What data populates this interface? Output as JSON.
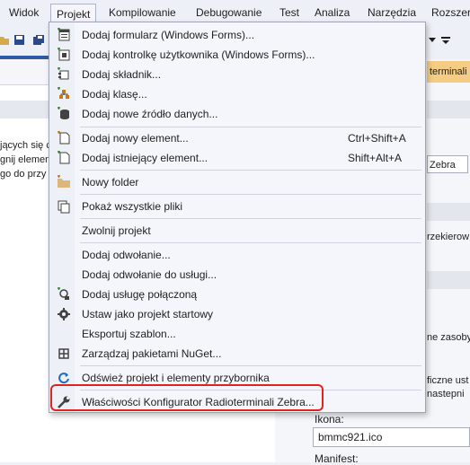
{
  "menubar": {
    "items": [
      "Widok",
      "Projekt",
      "Kompilowanie",
      "Debugowanie",
      "Test",
      "Analiza",
      "Narzędzia",
      "Rozszerz"
    ],
    "active": "Projekt"
  },
  "left_pane": {
    "lines": [
      "jących się c",
      "gnij elemen",
      "go do przy"
    ]
  },
  "right_pane": {
    "tab_label": "terminali",
    "field_zebra": "Zebra",
    "text_zakodowany": "rzekierow",
    "text_zasoby": "ne zasoby",
    "text_ficzne": "ficzne ust",
    "text_nastepni": "nastepni",
    "icon_label": "Ikona:",
    "icon_value": "bmmc921.ico",
    "manifest_label": "Manifest:"
  },
  "project_menu": {
    "items": [
      {
        "label": "Dodaj formularz (Windows Forms)...",
        "shortcut": "",
        "icon": "form-icon"
      },
      {
        "label": "Dodaj kontrolkę użytkownika (Windows Forms)...",
        "shortcut": "",
        "icon": "user-control-icon"
      },
      {
        "label": "Dodaj składnik...",
        "shortcut": "",
        "icon": "component-icon"
      },
      {
        "label": "Dodaj klasę...",
        "shortcut": "",
        "icon": "class-icon"
      },
      {
        "label": "Dodaj nowe źródło danych...",
        "shortcut": "",
        "icon": "datasource-icon"
      },
      {
        "label": "Dodaj nowy element...",
        "shortcut": "Ctrl+Shift+A",
        "icon": "new-item-icon"
      },
      {
        "label": "Dodaj istniejący element...",
        "shortcut": "Shift+Alt+A",
        "icon": "existing-item-icon"
      },
      {
        "label": "Nowy folder",
        "shortcut": "",
        "icon": "folder-icon"
      },
      {
        "label": "Pokaż wszystkie pliki",
        "shortcut": "",
        "icon": "show-all-files-icon"
      },
      {
        "label": "Zwolnij projekt",
        "shortcut": "",
        "icon": ""
      },
      {
        "label": "Dodaj odwołanie...",
        "shortcut": "",
        "icon": ""
      },
      {
        "label": "Dodaj odwołanie do usługi...",
        "shortcut": "",
        "icon": ""
      },
      {
        "label": "Dodaj usługę połączoną",
        "shortcut": "",
        "icon": "connected-service-icon"
      },
      {
        "label": "Ustaw jako projekt startowy",
        "shortcut": "",
        "icon": "gear-icon"
      },
      {
        "label": "Eksportuj szablon...",
        "shortcut": "",
        "icon": ""
      },
      {
        "label": "Zarządzaj pakietami NuGet...",
        "shortcut": "",
        "icon": "nuget-icon"
      },
      {
        "label": "Odśwież projekt i elementy przybornika",
        "shortcut": "",
        "icon": "refresh-icon"
      },
      {
        "label": "Właściwości Konfigurator Radioterminali Zebra...",
        "shortcut": "",
        "icon": "wrench-icon"
      }
    ]
  },
  "colors": {
    "highlight_outline": "#e0241c",
    "tab_orange": "#f5cc84",
    "menu_bg": "#f5f6fb"
  }
}
